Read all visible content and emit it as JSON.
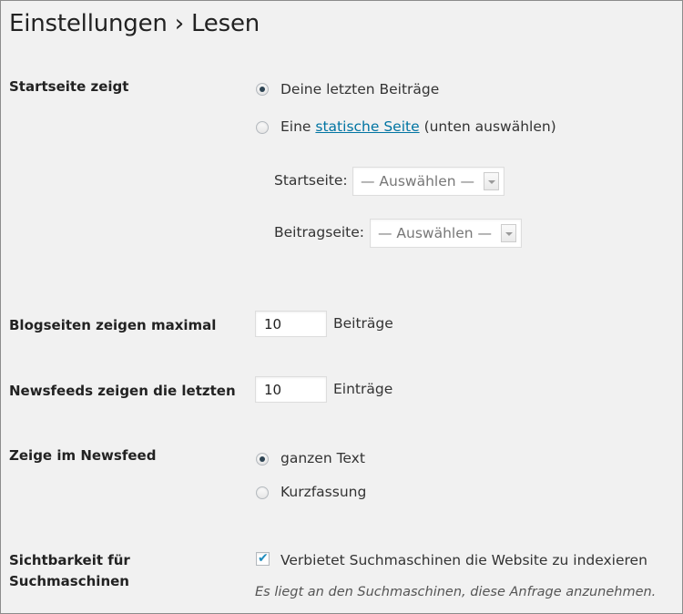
{
  "page": {
    "title": "Einstellungen › Lesen"
  },
  "front_page": {
    "label": "Startseite zeigt",
    "option_latest": "Deine letzten Beiträge",
    "option_static_prefix": "Eine",
    "option_static_link": "statische Seite",
    "option_static_suffix": "(unten auswählen)",
    "selected": "latest",
    "homepage_label": "Startseite:",
    "homepage_select": "— Auswählen —",
    "postspage_label": "Beitragseite:",
    "postspage_select": "— Auswählen —"
  },
  "blog_pages": {
    "label": "Blogseiten zeigen maximal",
    "value": "10",
    "unit": "Beiträge"
  },
  "feeds": {
    "label": "Newsfeeds zeigen die letzten",
    "value": "10",
    "unit": "Einträge"
  },
  "feed_content": {
    "label": "Zeige im Newsfeed",
    "option_full": "ganzen Text",
    "option_summary": "Kurzfassung",
    "selected": "full"
  },
  "visibility": {
    "label_line1": "Sichtbarkeit für",
    "label_line2": "Suchmaschinen",
    "checkbox_label": "Verbietet Suchmaschinen die Website zu indexieren",
    "checked": true,
    "description": "Es liegt an den Suchmaschinen, diese Anfrage anzunehmen."
  },
  "icons": {
    "check": "checkmark-icon",
    "dropdown": "chevron-down-icon"
  }
}
